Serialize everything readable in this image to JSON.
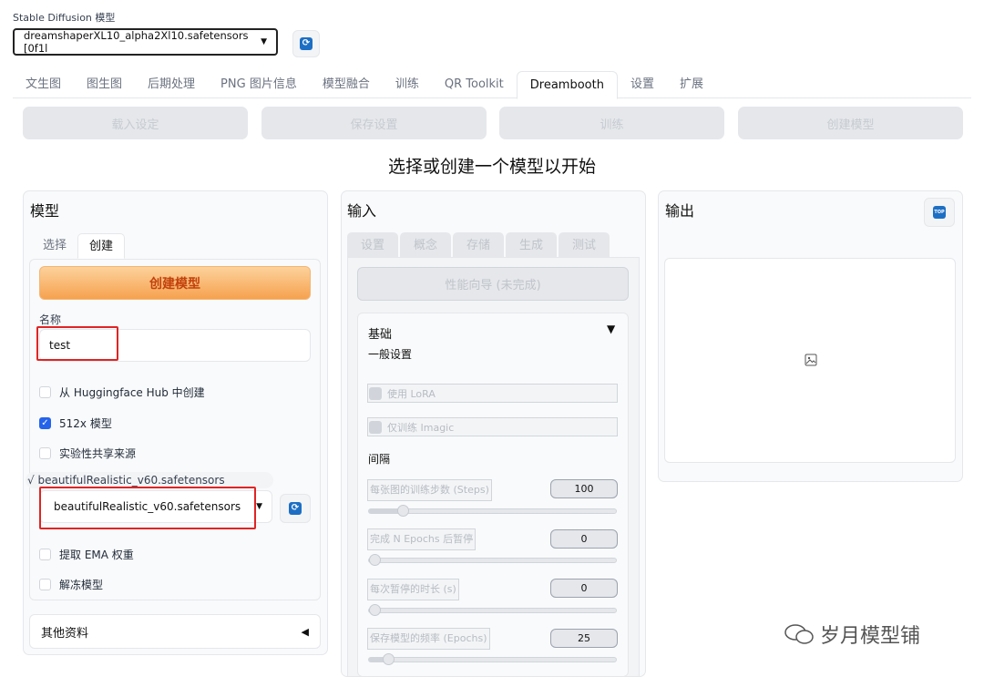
{
  "model_label": "Stable Diffusion 模型",
  "model_value": "dreamshaperXL10_alpha2Xl10.safetensors [0f1l",
  "tabs": [
    "文生图",
    "图生图",
    "后期处理",
    "PNG 图片信息",
    "模型融合",
    "训练",
    "QR Toolkit",
    "Dreambooth",
    "设置",
    "扩展"
  ],
  "active_tab": "Dreambooth",
  "actions": [
    "载入设定",
    "保存设置",
    "训练",
    "创建模型"
  ],
  "headline": "选择或创建一个模型以开始",
  "model_panel": {
    "title": "模型",
    "subtabs": [
      "选择",
      "创建"
    ],
    "create_button": "创建模型",
    "name_label": "名称",
    "name_value": "test",
    "checks": [
      {
        "label": "从 Huggingface Hub 中创建",
        "checked": false
      },
      {
        "label": "512x 模型",
        "checked": true
      },
      {
        "label": "实验性共享来源",
        "checked": false
      }
    ],
    "source_tag": "√ beautifulRealistic_v60.safetensors",
    "source_value": "beautifulRealistic_v60.safetensors",
    "extra_checks": [
      {
        "label": "提取 EMA 权重",
        "checked": false
      },
      {
        "label": "解冻模型",
        "checked": false
      }
    ],
    "other_info": "其他资料"
  },
  "input_panel": {
    "title": "输入",
    "tabs": [
      "设置",
      "概念",
      "存储",
      "生成",
      "测试"
    ],
    "wizard_button": "性能向导 (未完成)",
    "basic_title": "基础",
    "basic_sub": "一般设置",
    "use_lora": "使用 LoRA",
    "imagic": "仅训练 Imagic",
    "interval_label": "间隔",
    "sliders": [
      {
        "label": "每张图的训练步数 (Steps)",
        "value": "100",
        "fraction": 0.12
      },
      {
        "label": "完成 N Epochs 后暂停",
        "value": "0",
        "fraction": 0
      },
      {
        "label": "每次暂停的时长 (s)",
        "value": "0",
        "fraction": 0
      },
      {
        "label": "保存模型的频率 (Epochs)",
        "value": "25",
        "fraction": 0.06
      }
    ]
  },
  "output_panel": {
    "title": "输出",
    "top_label": "TOP"
  },
  "watermark": "岁月模型铺"
}
